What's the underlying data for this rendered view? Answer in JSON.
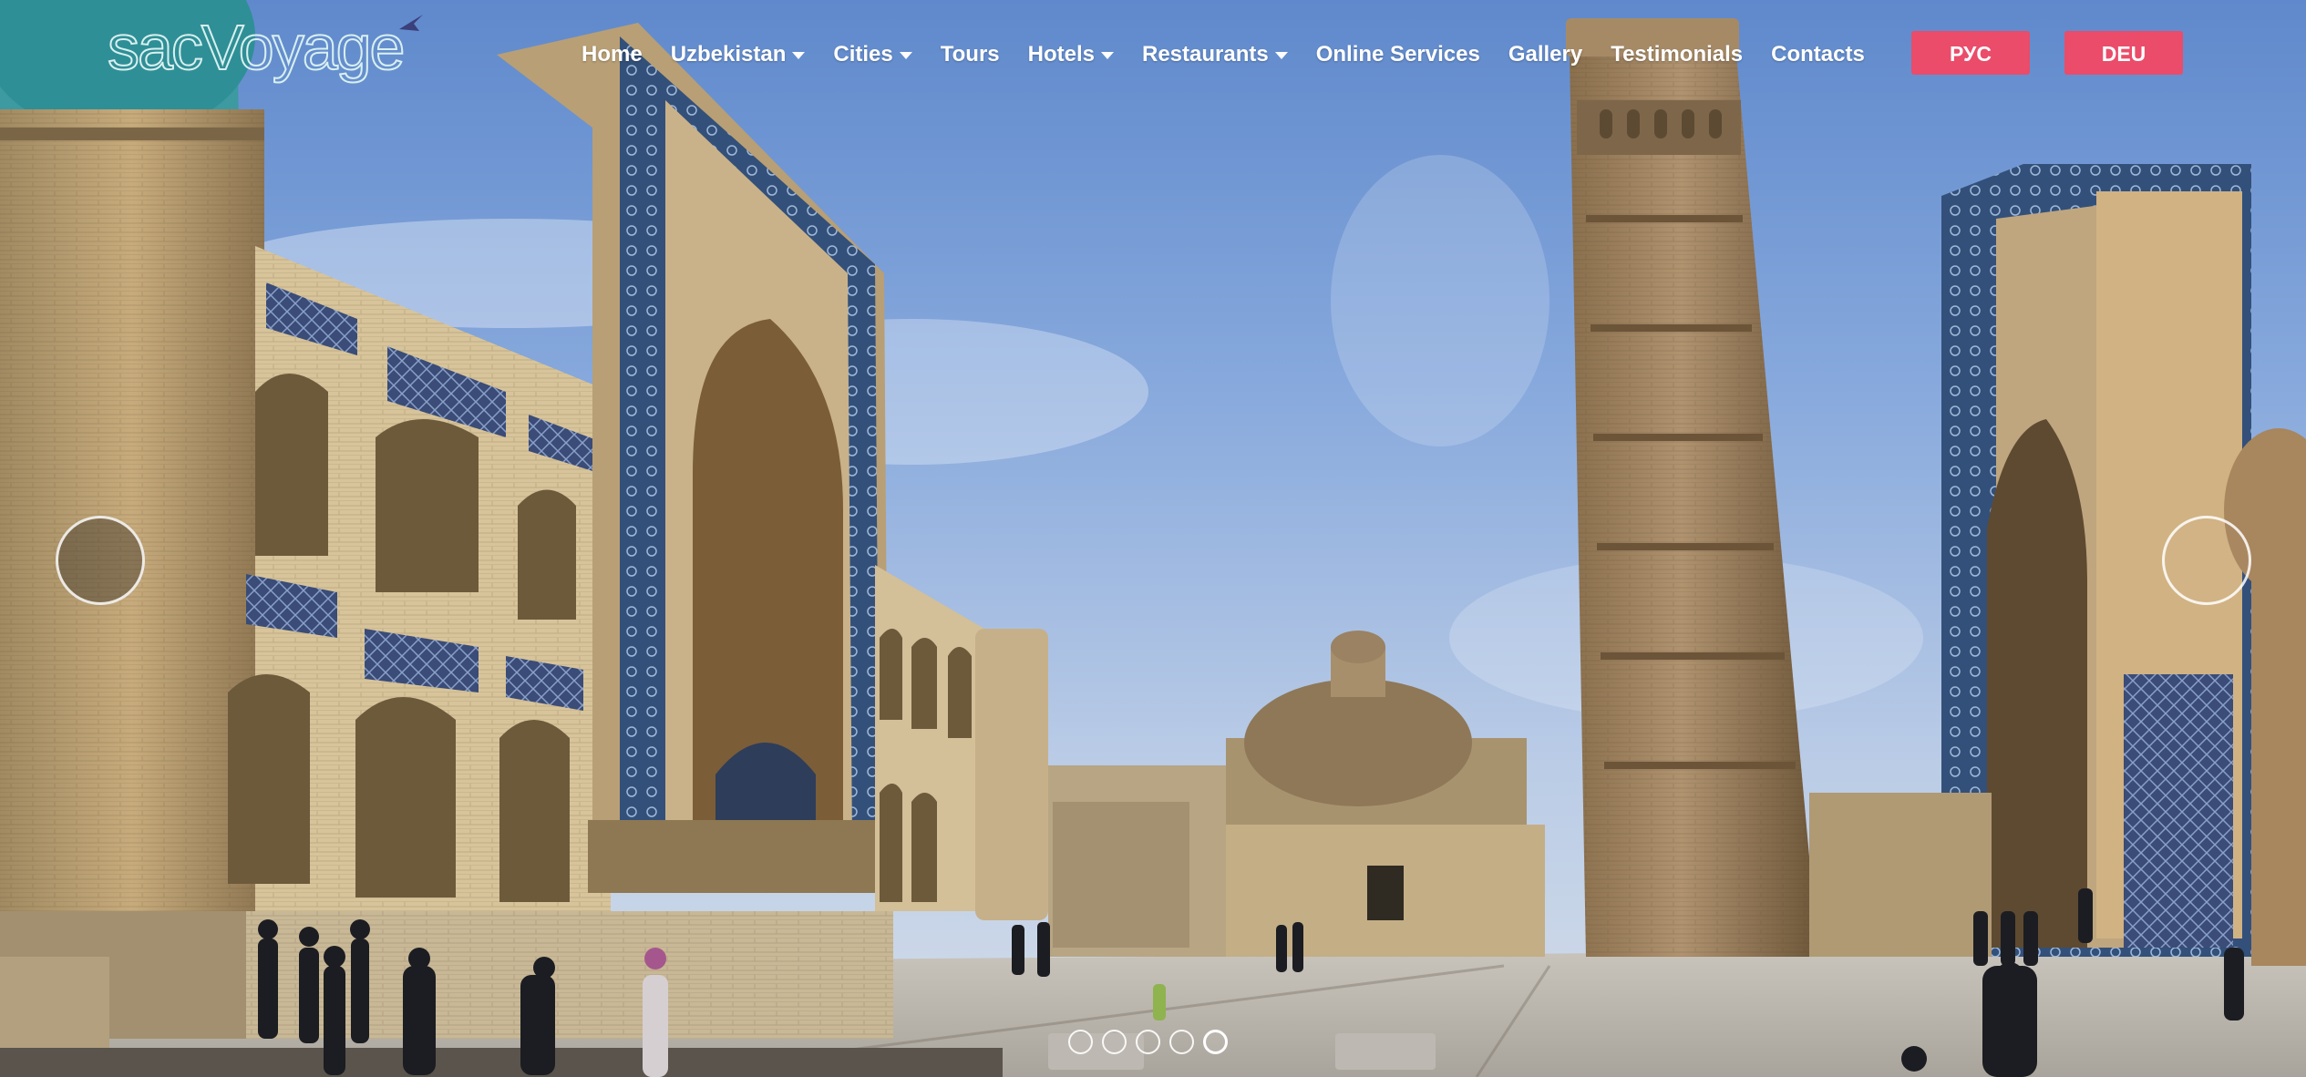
{
  "logo": {
    "text": "sacVoyage",
    "icon": "airplane-icon",
    "color": "#d8f0f0"
  },
  "nav": {
    "items": [
      {
        "label": "Home",
        "dropdown": false
      },
      {
        "label": "Uzbekistan",
        "dropdown": true
      },
      {
        "label": "Cities",
        "dropdown": true
      },
      {
        "label": "Tours",
        "dropdown": false
      },
      {
        "label": "Hotels",
        "dropdown": true
      },
      {
        "label": "Restaurants",
        "dropdown": true
      },
      {
        "label": "Online Services",
        "dropdown": false
      },
      {
        "label": "Gallery",
        "dropdown": false
      },
      {
        "label": "Testimonials",
        "dropdown": false
      },
      {
        "label": "Contacts",
        "dropdown": false
      }
    ],
    "languages": [
      "РУС",
      "DEU"
    ],
    "accent_color": "#ea4c6a"
  },
  "slider": {
    "prev_icon": "circle-prev-icon",
    "next_icon": "circle-next-icon",
    "slide_count": 5,
    "active_slide": 5
  }
}
